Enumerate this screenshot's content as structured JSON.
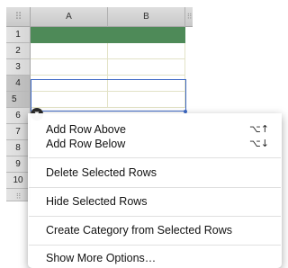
{
  "table": {
    "columns": [
      "A",
      "B"
    ],
    "rows": [
      "1",
      "2",
      "3",
      "4",
      "5",
      "6",
      "7",
      "8",
      "9",
      "10"
    ]
  },
  "context_menu": {
    "items": [
      {
        "label": "Add Row Above",
        "shortcut": "⌥↑"
      },
      {
        "label": "Add Row Below",
        "shortcut": "⌥↓"
      },
      {
        "label": "Delete Selected Rows"
      },
      {
        "label": "Hide Selected Rows"
      },
      {
        "label": "Create Category from Selected Rows"
      },
      {
        "label": "Show More Options…"
      }
    ]
  },
  "colors": {
    "header_fill": "#4e8a58",
    "selection": "#3d68c4"
  },
  "icons": {
    "row_menu": "chevron-down-icon",
    "grip": "grip-icon"
  }
}
